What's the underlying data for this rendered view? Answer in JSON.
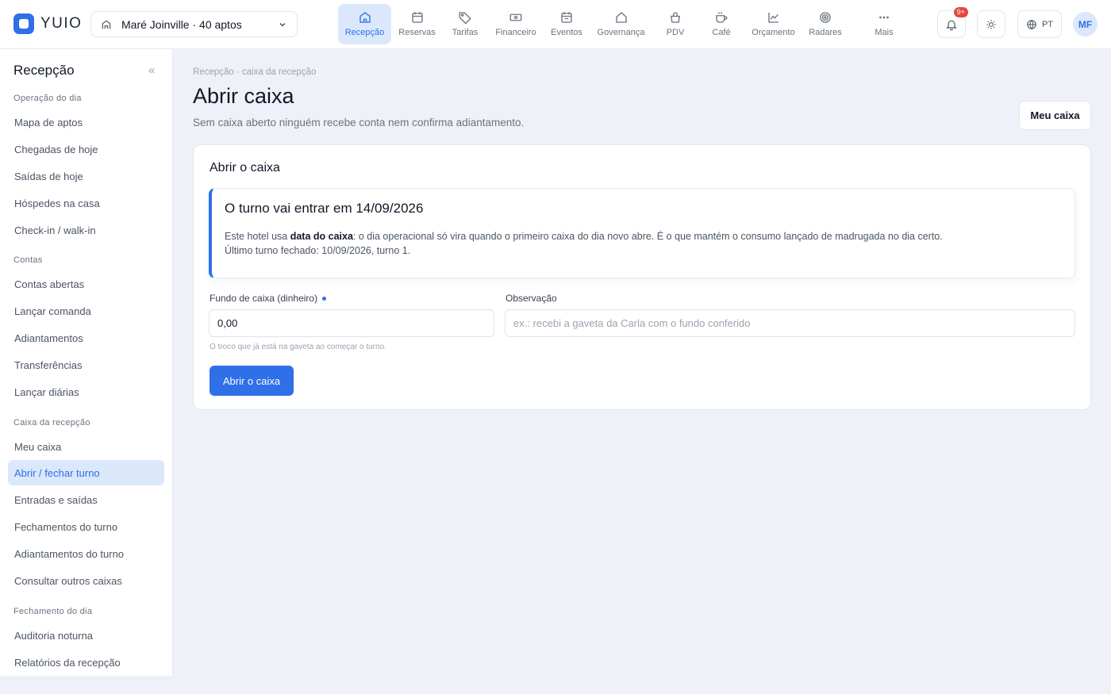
{
  "app": {
    "name": "YUIO"
  },
  "hotel_select": {
    "label": "Maré Joinville · 40 aptos"
  },
  "nav": [
    {
      "label": "Recepção",
      "icon": "home-icon",
      "active": true
    },
    {
      "label": "Reservas",
      "icon": "calendar-icon"
    },
    {
      "label": "Tarifas",
      "icon": "tag-icon"
    },
    {
      "label": "Financeiro",
      "icon": "money-icon"
    },
    {
      "label": "Eventos",
      "icon": "calendar-event-icon"
    },
    {
      "label": "Governança",
      "icon": "house-icon"
    },
    {
      "label": "PDV",
      "icon": "basket-icon"
    },
    {
      "label": "Café",
      "icon": "coffee-icon"
    },
    {
      "label": "Orçamento",
      "icon": "chart-line-icon"
    },
    {
      "label": "Radares",
      "icon": "radar-icon"
    },
    {
      "label": "Mais",
      "icon": "more-icon"
    }
  ],
  "topright": {
    "notif_badge": "9+",
    "lang": "PT",
    "avatar": "MF"
  },
  "sidebar": {
    "title": "Recepção",
    "collapse": "«",
    "sections": [
      {
        "label": "Operação do dia",
        "items": [
          "Mapa de aptos",
          "Chegadas de hoje",
          "Saídas de hoje",
          "Hóspedes na casa",
          "Check-in / walk-in"
        ]
      },
      {
        "label": "Contas",
        "items": [
          "Contas abertas",
          "Lançar comanda",
          "Adiantamentos",
          "Transferências",
          "Lançar diárias"
        ]
      },
      {
        "label": "Caixa da recepção",
        "items": [
          "Meu caixa",
          "Abrir / fechar turno",
          "Entradas e saídas",
          "Fechamentos do turno",
          "Adiantamentos do turno",
          "Consultar outros caixas"
        ]
      },
      {
        "label": "Fechamento do dia",
        "items": [
          "Auditoria noturna",
          "Relatórios da recepção"
        ]
      }
    ],
    "active_item": "Abrir / fechar turno"
  },
  "page": {
    "breadcrumb": "Recepção · caixa da recepção",
    "title": "Abrir caixa",
    "subtitle": "Sem caixa aberto ninguém recebe conta nem confirma adiantamento.",
    "meu_caixa_button": "Meu caixa"
  },
  "card": {
    "title": "Abrir o caixa",
    "notice": {
      "title": "O turno vai entrar em 14/09/2026",
      "line1_pre": "Este hotel usa ",
      "line1_bold": "data do caixa",
      "line1_post": ": o dia operacional só vira quando o primeiro caixa do dia novo abre. É o que mantém o consumo lançado de madrugada no dia certo.",
      "line2": "Último turno fechado: 10/09/2026, turno 1."
    },
    "fundo": {
      "label": "Fundo de caixa (dinheiro)",
      "value": "0,00",
      "hint": "O troco que já está na gaveta ao começar o turno."
    },
    "observacao": {
      "label": "Observação",
      "placeholder": "ex.: recebi a gaveta da Carla com o fundo conferido"
    },
    "submit": "Abrir o caixa"
  }
}
